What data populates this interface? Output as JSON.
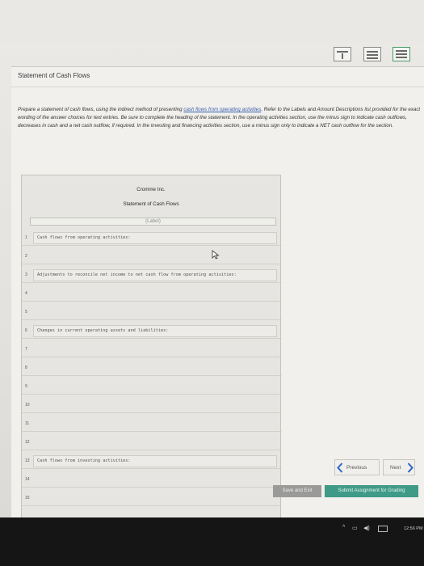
{
  "panel": {
    "title": "Statement of Cash Flows",
    "instructions_before_link": "Prepare a statement of cash flows, using the indirect method of presenting ",
    "instructions_link": "cash flows from operating activities",
    "instructions_after_link": ". Refer to the Labels and Amount Descriptions list provided for the exact wording of the answer choices for text entries. Be sure to complete the heading of the statement. In the operating activities section, use the minus sign to indicate cash outflows, decreases in cash and a net cash outflow, if required. In the investing and financing activities section, use a minus sign only to indicate a NET cash outflow for the section."
  },
  "worksheet": {
    "company": "Cromme Inc.",
    "statement": "Statement of Cash Flows",
    "label_placeholder": "(Label)",
    "rows": [
      {
        "num": "1",
        "text": "Cash flows from operating activities:"
      },
      {
        "num": "2",
        "text": ""
      },
      {
        "num": "3",
        "text": "Adjustments to reconcile net income to net cash flow from operating activities:"
      },
      {
        "num": "4",
        "text": ""
      },
      {
        "num": "5",
        "text": ""
      },
      {
        "num": "6",
        "text": "Changes in current operating assets and liabilities:"
      },
      {
        "num": "7",
        "text": ""
      },
      {
        "num": "8",
        "text": ""
      },
      {
        "num": "9",
        "text": ""
      },
      {
        "num": "10",
        "text": ""
      },
      {
        "num": "11",
        "text": ""
      },
      {
        "num": "12",
        "text": ""
      },
      {
        "num": "13",
        "text": "Cash flows from investing activities:"
      },
      {
        "num": "14",
        "text": ""
      },
      {
        "num": "15",
        "text": ""
      }
    ]
  },
  "nav": {
    "previous": "Previous",
    "next": "Next"
  },
  "actions": {
    "save": "Save and Exit",
    "submit": "Submit Assignment for Grading"
  },
  "taskbar": {
    "time": "12:56 PM"
  }
}
